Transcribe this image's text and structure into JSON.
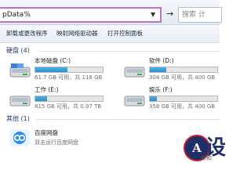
{
  "address_bar": {
    "path": "pData%",
    "go": "→"
  },
  "search": {
    "placeholder": "搜索 计"
  },
  "toolbar": {
    "items": [
      {
        "label": "卸载或更改程序"
      },
      {
        "label": "映射网络驱动器"
      },
      {
        "label": "打开控制面板"
      }
    ]
  },
  "hard_disks": {
    "header": "硬盘 (4)",
    "drives": [
      {
        "name": "本地磁盘 (C:)",
        "info": "61.7 GB 可用，共 118 GB",
        "used_fraction": 0.48,
        "color": "#2a8fd0"
      },
      {
        "name": "软件 (D:)",
        "info": "304 GB 可用，共 400 GB",
        "used_fraction": 0.24,
        "color": "#2a8fd0"
      },
      {
        "name": "工作 (E:)",
        "info": "815 GB 可用，共 0.97 TB",
        "used_fraction": 0.18,
        "color": "#2a8fd0"
      },
      {
        "name": "娱乐 (F:)",
        "info": "358 GB 可用，共 400 GB",
        "used_fraction": 0.1,
        "color": "#2a8fd0"
      }
    ]
  },
  "other": {
    "header": "其他 (1)",
    "items": [
      {
        "name": "百度网盘",
        "desc": "双击运行百度网盘"
      }
    ]
  },
  "watermark": {
    "letter": "A",
    "char": "设",
    "sub": "来和"
  }
}
